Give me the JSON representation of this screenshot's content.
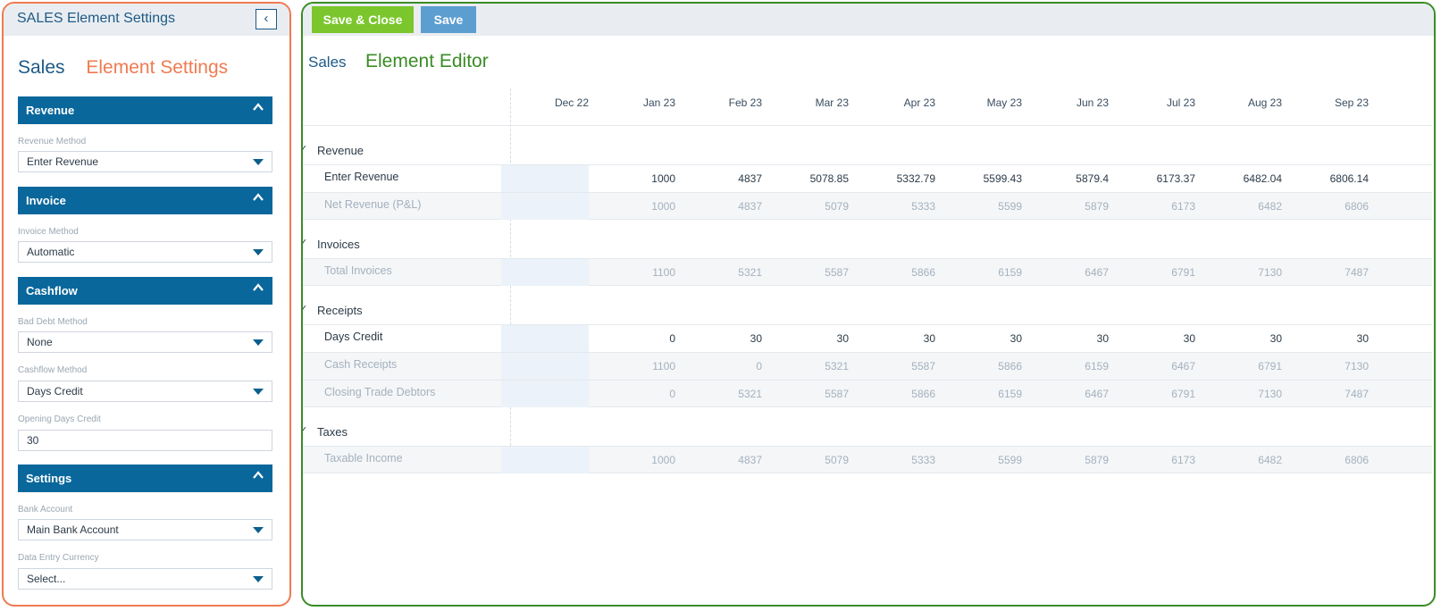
{
  "left_panel": {
    "title": "SALES Element Settings",
    "collapse_icon": "chevron-left-icon",
    "heading_main": "Sales",
    "heading_sub": "Element Settings",
    "sections": {
      "revenue": "Revenue",
      "invoice": "Invoice",
      "cashflow": "Cashflow",
      "settings": "Settings"
    },
    "fields": {
      "revenue_method": {
        "label": "Revenue Method",
        "value": "Enter Revenue"
      },
      "invoice_method": {
        "label": "Invoice Method",
        "value": "Automatic"
      },
      "bad_debt_method": {
        "label": "Bad Debt Method",
        "value": "None"
      },
      "cashflow_method": {
        "label": "Cashflow Method",
        "value": "Days Credit"
      },
      "opening_days_credit": {
        "label": "Opening Days Credit",
        "value": "30"
      },
      "bank_account": {
        "label": "Bank Account",
        "value": "Main Bank Account"
      },
      "data_entry_currency": {
        "label": "Data Entry Currency",
        "value": "Select..."
      }
    },
    "accent_color": "#ef7b51",
    "section_color": "#09679c"
  },
  "right_panel": {
    "toolbar": {
      "save_close": "Save & Close",
      "save": "Save"
    },
    "heading_main": "Sales",
    "heading_sub": "Element Editor",
    "accent_color": "#3a8c26",
    "months": [
      "Dec 22",
      "Jan 23",
      "Feb 23",
      "Mar 23",
      "Apr 23",
      "May 23",
      "Jun 23",
      "Jul 23",
      "Aug 23",
      "Sep 23"
    ],
    "groups": [
      {
        "name": "Revenue",
        "rows": [
          {
            "name": "Enter Revenue",
            "kind": "input",
            "values": [
              "1000",
              "4837",
              "5078.85",
              "5332.79",
              "5599.43",
              "5879.4",
              "6173.37",
              "6482.04",
              "6806.14"
            ]
          },
          {
            "name": "Net Revenue (P&L)",
            "kind": "calc",
            "values": [
              "1000",
              "4837",
              "5079",
              "5333",
              "5599",
              "5879",
              "6173",
              "6482",
              "6806"
            ]
          }
        ]
      },
      {
        "name": "Invoices",
        "rows": [
          {
            "name": "Total Invoices",
            "kind": "calc",
            "values": [
              "1100",
              "5321",
              "5587",
              "5866",
              "6159",
              "6467",
              "6791",
              "7130",
              "7487"
            ]
          }
        ]
      },
      {
        "name": "Receipts",
        "rows": [
          {
            "name": "Days Credit",
            "kind": "input",
            "values": [
              "0",
              "30",
              "30",
              "30",
              "30",
              "30",
              "30",
              "30",
              "30"
            ]
          },
          {
            "name": "Cash Receipts",
            "kind": "calc",
            "values": [
              "1100",
              "0",
              "5321",
              "5587",
              "5866",
              "6159",
              "6467",
              "6791",
              "7130"
            ]
          },
          {
            "name": "Closing Trade Debtors",
            "kind": "calc",
            "values": [
              "0",
              "5321",
              "5587",
              "5866",
              "6159",
              "6467",
              "6791",
              "7130",
              "7487"
            ]
          }
        ]
      },
      {
        "name": "Taxes",
        "rows": [
          {
            "name": "Taxable Income",
            "kind": "calc",
            "values": [
              "1000",
              "4837",
              "5079",
              "5333",
              "5599",
              "5879",
              "6173",
              "6482",
              "6806"
            ]
          }
        ]
      }
    ]
  }
}
